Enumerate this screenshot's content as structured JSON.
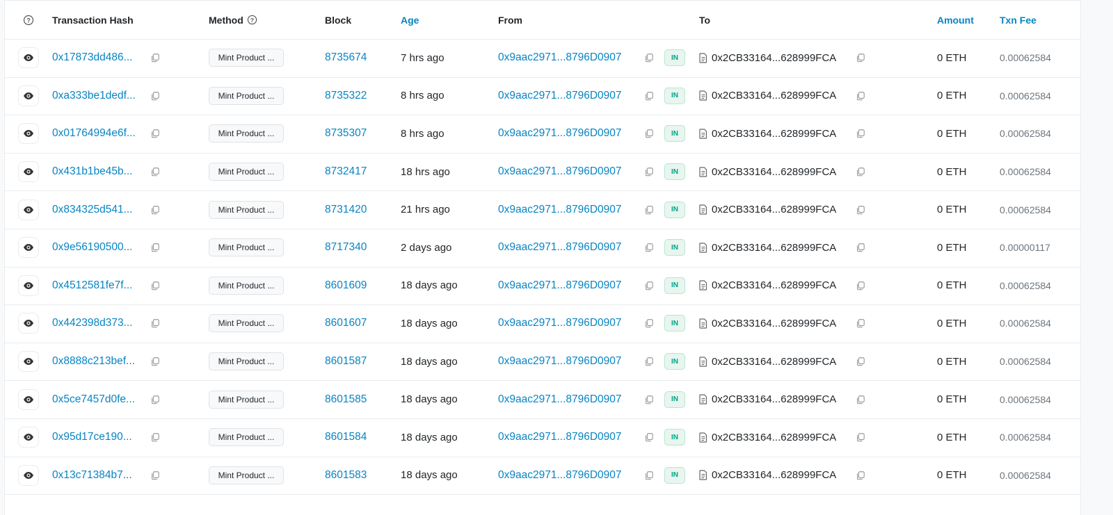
{
  "table": {
    "headers": {
      "transaction_hash": "Transaction Hash",
      "method": "Method",
      "block": "Block",
      "age": "Age",
      "from": "From",
      "to": "To",
      "amount": "Amount",
      "txn_fee": "Txn Fee"
    },
    "rows": [
      {
        "hash": "0x17873dd486...",
        "method": "Mint Product ...",
        "block": "8735674",
        "age": "7 hrs ago",
        "from": "0x9aac2971...8796D0907",
        "direction": "IN",
        "to": "0x2CB33164...628999FCA",
        "amount": "0 ETH",
        "fee": "0.00062584"
      },
      {
        "hash": "0xa333be1dedf...",
        "method": "Mint Product ...",
        "block": "8735322",
        "age": "8 hrs ago",
        "from": "0x9aac2971...8796D0907",
        "direction": "IN",
        "to": "0x2CB33164...628999FCA",
        "amount": "0 ETH",
        "fee": "0.00062584"
      },
      {
        "hash": "0x01764994e6f...",
        "method": "Mint Product ...",
        "block": "8735307",
        "age": "8 hrs ago",
        "from": "0x9aac2971...8796D0907",
        "direction": "IN",
        "to": "0x2CB33164...628999FCA",
        "amount": "0 ETH",
        "fee": "0.00062584"
      },
      {
        "hash": "0x431b1be45b...",
        "method": "Mint Product ...",
        "block": "8732417",
        "age": "18 hrs ago",
        "from": "0x9aac2971...8796D0907",
        "direction": "IN",
        "to": "0x2CB33164...628999FCA",
        "amount": "0 ETH",
        "fee": "0.00062584"
      },
      {
        "hash": "0x834325d541...",
        "method": "Mint Product ...",
        "block": "8731420",
        "age": "21 hrs ago",
        "from": "0x9aac2971...8796D0907",
        "direction": "IN",
        "to": "0x2CB33164...628999FCA",
        "amount": "0 ETH",
        "fee": "0.00062584"
      },
      {
        "hash": "0x9e56190500...",
        "method": "Mint Product ...",
        "block": "8717340",
        "age": "2 days ago",
        "from": "0x9aac2971...8796D0907",
        "direction": "IN",
        "to": "0x2CB33164...628999FCA",
        "amount": "0 ETH",
        "fee": "0.00000117"
      },
      {
        "hash": "0x4512581fe7f...",
        "method": "Mint Product ...",
        "block": "8601609",
        "age": "18 days ago",
        "from": "0x9aac2971...8796D0907",
        "direction": "IN",
        "to": "0x2CB33164...628999FCA",
        "amount": "0 ETH",
        "fee": "0.00062584"
      },
      {
        "hash": "0x442398d373...",
        "method": "Mint Product ...",
        "block": "8601607",
        "age": "18 days ago",
        "from": "0x9aac2971...8796D0907",
        "direction": "IN",
        "to": "0x2CB33164...628999FCA",
        "amount": "0 ETH",
        "fee": "0.00062584"
      },
      {
        "hash": "0x8888c213bef...",
        "method": "Mint Product ...",
        "block": "8601587",
        "age": "18 days ago",
        "from": "0x9aac2971...8796D0907",
        "direction": "IN",
        "to": "0x2CB33164...628999FCA",
        "amount": "0 ETH",
        "fee": "0.00062584"
      },
      {
        "hash": "0x5ce7457d0fe...",
        "method": "Mint Product ...",
        "block": "8601585",
        "age": "18 days ago",
        "from": "0x9aac2971...8796D0907",
        "direction": "IN",
        "to": "0x2CB33164...628999FCA",
        "amount": "0 ETH",
        "fee": "0.00062584"
      },
      {
        "hash": "0x95d17ce190...",
        "method": "Mint Product ...",
        "block": "8601584",
        "age": "18 days ago",
        "from": "0x9aac2971...8796D0907",
        "direction": "IN",
        "to": "0x2CB33164...628999FCA",
        "amount": "0 ETH",
        "fee": "0.00062584"
      },
      {
        "hash": "0x13c71384b7...",
        "method": "Mint Product ...",
        "block": "8601583",
        "age": "18 days ago",
        "from": "0x9aac2971...8796D0907",
        "direction": "IN",
        "to": "0x2CB33164...628999FCA",
        "amount": "0 ETH",
        "fee": "0.00062584"
      }
    ]
  },
  "icons": {
    "header_help": "question-circle-icon",
    "method_help": "question-circle-icon",
    "row_preview": "eye-icon",
    "copy": "copy-icon",
    "contract": "document-icon"
  },
  "colors": {
    "link": "#0784c3",
    "in_badge_text": "#00a186",
    "in_badge_bg": "#e7f6ee",
    "border": "#e9ecef",
    "muted": "#6c757d"
  }
}
